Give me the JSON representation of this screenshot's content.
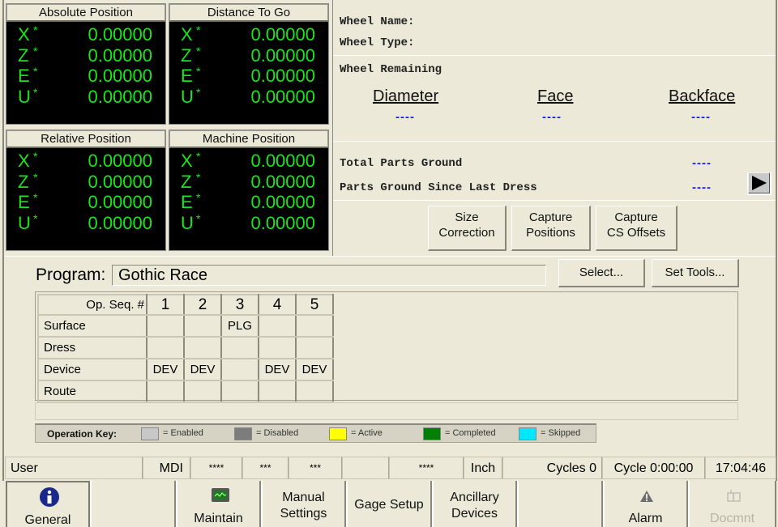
{
  "dro": [
    {
      "title": "Absolute Position",
      "axes": [
        {
          "axis": "X",
          "flag": "*",
          "value": "0.00000"
        },
        {
          "axis": "Z",
          "flag": "*",
          "value": "0.00000"
        },
        {
          "axis": "E",
          "flag": "*",
          "value": "0.00000"
        },
        {
          "axis": "U",
          "flag": "*",
          "value": "0.00000"
        }
      ]
    },
    {
      "title": "Distance To Go",
      "axes": [
        {
          "axis": "X",
          "flag": "*",
          "value": "0.00000"
        },
        {
          "axis": "Z",
          "flag": "*",
          "value": "0.00000"
        },
        {
          "axis": "E",
          "flag": "*",
          "value": "0.00000"
        },
        {
          "axis": "U",
          "flag": "*",
          "value": "0.00000"
        }
      ]
    },
    {
      "title": "Relative Position",
      "axes": [
        {
          "axis": "X",
          "flag": "*",
          "value": "0.00000"
        },
        {
          "axis": "Z",
          "flag": "*",
          "value": "0.00000"
        },
        {
          "axis": "E",
          "flag": "*",
          "value": "0.00000"
        },
        {
          "axis": "U",
          "flag": "*",
          "value": "0.00000"
        }
      ]
    },
    {
      "title": "Machine Position",
      "axes": [
        {
          "axis": "X",
          "flag": "*",
          "value": "0.00000"
        },
        {
          "axis": "Z",
          "flag": "*",
          "value": "0.00000"
        },
        {
          "axis": "E",
          "flag": "*",
          "value": "0.00000"
        },
        {
          "axis": "U",
          "flag": "*",
          "value": "0.00000"
        }
      ]
    }
  ],
  "wheel": {
    "name_label": "Wheel Name:",
    "name_value": "",
    "type_label": "Wheel Type:",
    "type_value": "",
    "remaining_label": "Wheel Remaining",
    "columns": [
      {
        "label": "Diameter",
        "value": "----"
      },
      {
        "label": "Face",
        "value": "----"
      },
      {
        "label": "Backface",
        "value": "----"
      }
    ]
  },
  "parts": {
    "total_label": "Total Parts Ground",
    "total_value": "----",
    "since_dress_label": "Parts Ground Since Last Dress",
    "since_dress_value": "----",
    "next_icon": "play-arrow-icon"
  },
  "actions": {
    "size_correction": [
      "Size",
      "Correction"
    ],
    "capture_positions": [
      "Capture",
      "Positions"
    ],
    "capture_cs_offsets": [
      "Capture",
      "CS Offsets"
    ]
  },
  "program": {
    "label": "Program:",
    "value": "Gothic Race",
    "select_label": "Select...",
    "set_tools_label": "Set Tools..."
  },
  "ops_table": {
    "header_label": "Op. Seq. #",
    "columns": [
      "1",
      "2",
      "3",
      "4",
      "5"
    ],
    "rows": [
      {
        "label": "Surface",
        "cells": [
          "",
          "",
          "PLG",
          "",
          ""
        ]
      },
      {
        "label": "Dress",
        "cells": [
          "",
          "",
          "",
          "",
          ""
        ]
      },
      {
        "label": "Device",
        "cells": [
          "DEV",
          "DEV",
          "",
          "DEV",
          "DEV"
        ]
      },
      {
        "label": "Route",
        "cells": [
          "",
          "",
          "",
          "",
          ""
        ]
      }
    ]
  },
  "operation_key": {
    "label": "Operation Key:",
    "items": [
      {
        "label": "= Enabled",
        "color": "#c8c8c8"
      },
      {
        "label": "= Disabled",
        "color": "#7c7c7c"
      },
      {
        "label": "= Active",
        "color": "#ffff00"
      },
      {
        "label": "= Completed",
        "color": "#008000"
      },
      {
        "label": "= Skipped",
        "color": "#00e8ff"
      }
    ]
  },
  "status_bar": {
    "user": "User",
    "mode": "MDI",
    "f1": "****",
    "f2": "***",
    "f3": "***",
    "f4": "",
    "f5": "****",
    "units": "Inch",
    "cycles": "Cycles 0",
    "cycle_time": "Cycle 0:00:00",
    "clock": "17:04:46"
  },
  "nav": {
    "general": "General",
    "maintain": "Maintain",
    "manual_settings": [
      "Manual",
      "Settings"
    ],
    "gage_setup": "Gage Setup",
    "ancillary_devices": [
      "Ancillary",
      "Devices"
    ],
    "alarm": "Alarm",
    "document": "Docmnt"
  }
}
